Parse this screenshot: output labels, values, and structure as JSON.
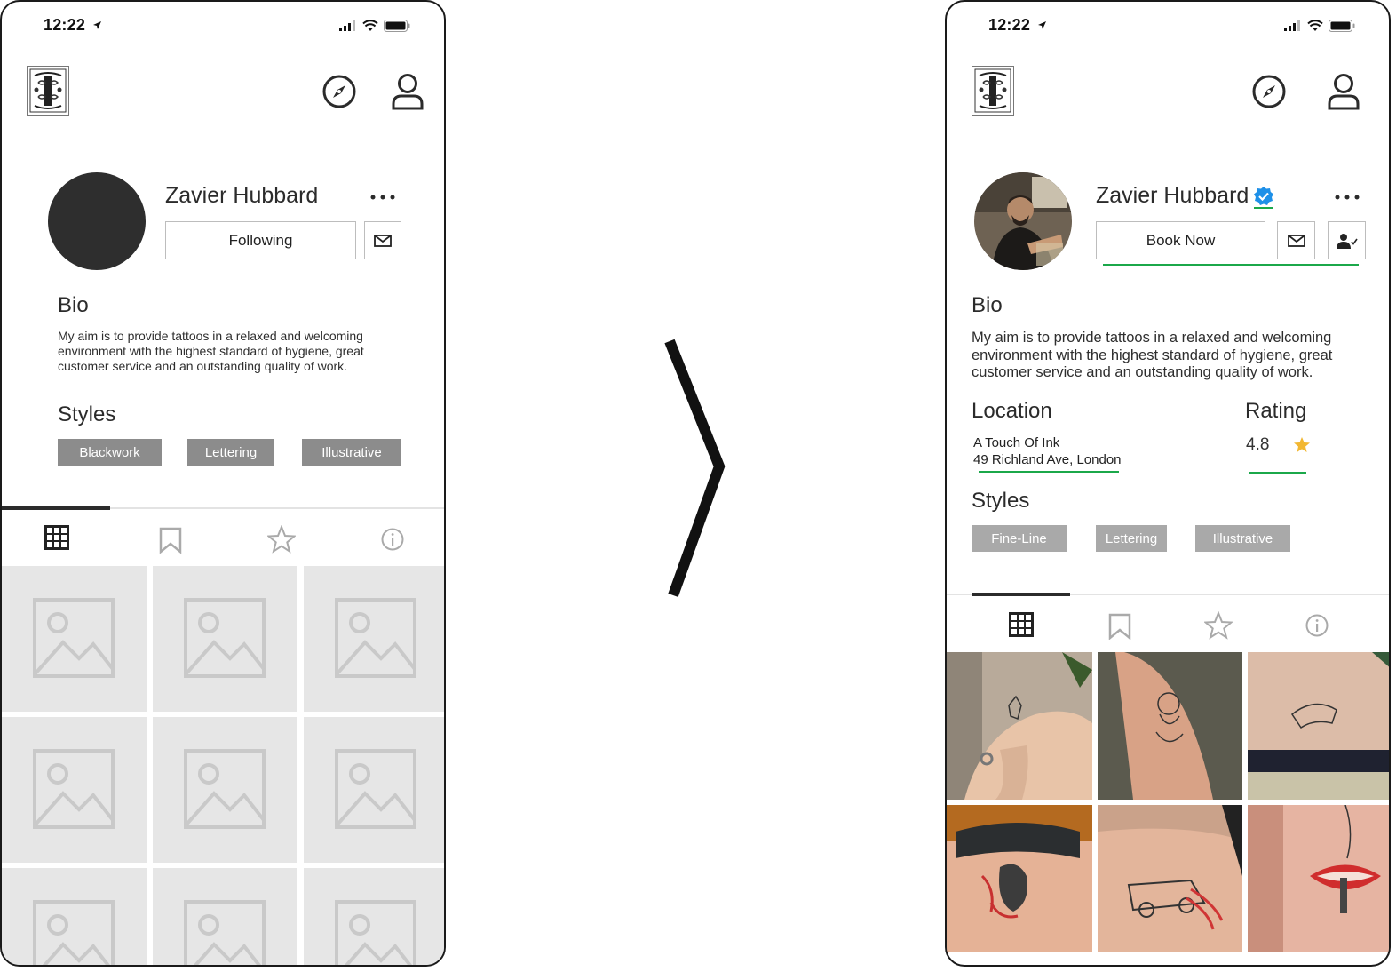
{
  "status_bar": {
    "time": "12:22"
  },
  "left_screen": {
    "profile": {
      "name": "Zavier Hubbard",
      "follow_button": "Following",
      "bio_heading": "Bio",
      "bio_text": "My aim is to provide tattoos in a relaxed and welcoming environment with the highest standard of hygiene, great customer service and an outstanding quality of work.",
      "styles_heading": "Styles",
      "styles": [
        "Blackwork",
        "Lettering",
        "Illustrative"
      ]
    }
  },
  "right_screen": {
    "profile": {
      "name": "Zavier Hubbard",
      "book_button": "Book Now",
      "bio_heading": "Bio",
      "bio_text": "My aim is to provide tattoos in a relaxed and welcoming environment with the highest standard of hygiene, great customer service and an outstanding quality of work.",
      "location_heading": "Location",
      "location_name": "A Touch Of Ink",
      "location_address": "49  Richland Ave, London",
      "rating_heading": "Rating",
      "rating_value": "4.8",
      "styles_heading": "Styles",
      "styles": [
        "Fine-Line",
        "Lettering",
        "Illustrative"
      ]
    }
  },
  "tabs": [
    "grid-icon",
    "bookmark-icon",
    "star-icon",
    "info-icon"
  ],
  "colors": {
    "accent_green": "#1ba84a",
    "verified_blue": "#1e90e8",
    "rating_star": "#f2b731",
    "tag_gray": "#8c8c8c",
    "placeholder_gray": "#e6e6e6"
  }
}
